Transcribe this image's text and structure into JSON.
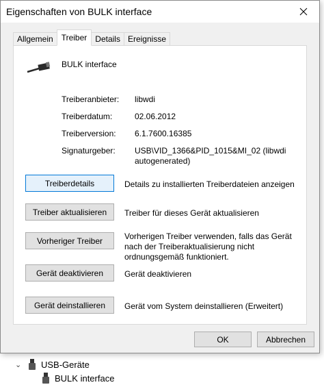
{
  "window": {
    "title": "Eigenschaften von BULK interface"
  },
  "tabs": [
    {
      "label": "Allgemein"
    },
    {
      "label": "Treiber"
    },
    {
      "label": "Details"
    },
    {
      "label": "Ereignisse"
    }
  ],
  "device": {
    "name": "BULK interface",
    "icon": "usb-cable-icon"
  },
  "info": {
    "provider_label": "Treiberanbieter:",
    "provider_value": "libwdi",
    "date_label": "Treiberdatum:",
    "date_value": "02.06.2012",
    "version_label": "Treiberversion:",
    "version_value": "6.1.7600.16385",
    "signer_label": "Signaturgeber:",
    "signer_value": "USB\\VID_1366&PID_1015&MI_02 (libwdi autogenerated)"
  },
  "actions": [
    {
      "label": "Treiberdetails",
      "description": "Details zu installierten Treiberdateien anzeigen"
    },
    {
      "label": "Treiber aktualisieren",
      "description": "Treiber für dieses Gerät aktualisieren"
    },
    {
      "label": "Vorheriger Treiber",
      "description": "Vorherigen Treiber verwenden, falls das Gerät nach der Treiberaktualisierung nicht ordnungsgemäß funktioniert."
    },
    {
      "label": "Gerät deaktivieren",
      "description": "Gerät deaktivieren"
    },
    {
      "label": "Gerät deinstallieren",
      "description": "Gerät vom System deinstallieren (Erweitert)"
    }
  ],
  "footer": {
    "ok_label": "OK",
    "cancel_label": "Abbrechen"
  },
  "tree": {
    "category_label": "USB-Geräte",
    "child_label": "BULK interface"
  },
  "colors": {
    "focus_border": "#0078d7",
    "dialog_bg": "#f0f0f0"
  }
}
